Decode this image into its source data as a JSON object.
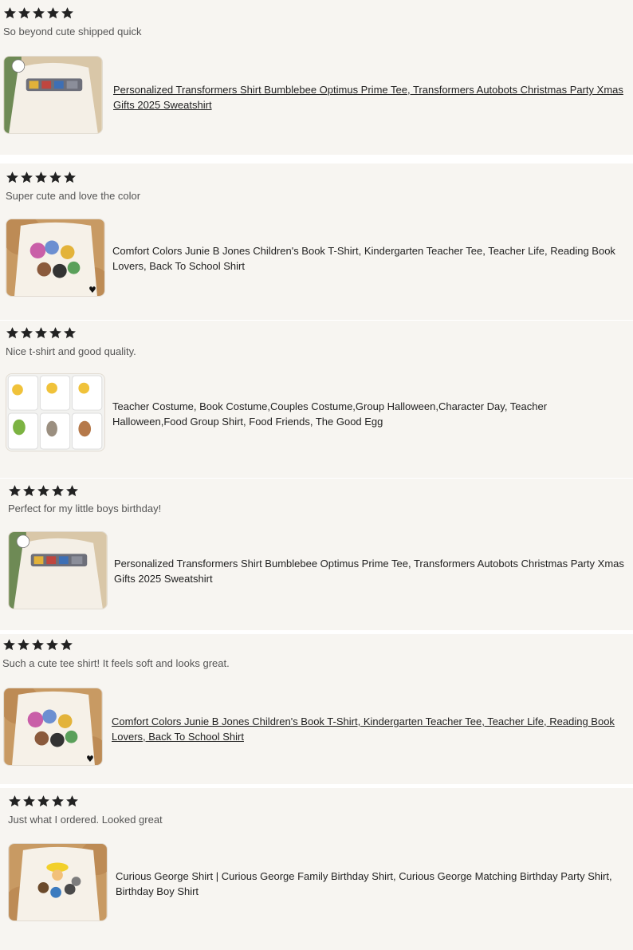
{
  "colors": {
    "card_bg": "#f7f5f1",
    "star": "#222222",
    "text_muted": "#555555"
  },
  "reviews": [
    {
      "rating": 5,
      "text": "So beyond cute shipped quick",
      "image": "transformers-shirt-photo",
      "product_title": "Personalized Transformers Shirt Bumblebee Optimus Prime Tee, Transformers Autobots Christmas Party Xmas Gifts 2025 Sweatshirt",
      "title_underlined": true
    },
    {
      "rating": 5,
      "text": "Super cute and love the color",
      "image": "junie-b-jones-shirt-photo",
      "product_title": "Comfort Colors Junie B Jones Children's Book T-Shirt, Kindergarten Teacher Tee, Teacher Life, Reading Book Lovers, Back To School Shirt",
      "title_underlined": false
    },
    {
      "rating": 5,
      "text": "Nice t-shirt and good quality.",
      "image": "food-group-shirts-photo",
      "product_title": "Teacher Costume, Book Costume,Couples Costume,Group Halloween,Character Day, Teacher Halloween,Food Group Shirt, Food Friends, The Good Egg",
      "title_underlined": false
    },
    {
      "rating": 5,
      "text": "Perfect for my little boys birthday!",
      "image": "transformers-shirt-photo",
      "product_title": "Personalized Transformers Shirt Bumblebee Optimus Prime Tee, Transformers Autobots Christmas Party Xmas Gifts 2025 Sweatshirt",
      "title_underlined": false
    },
    {
      "rating": 5,
      "text": "Such a cute tee shirt! It feels soft and looks great.",
      "image": "junie-b-jones-shirt-photo",
      "product_title": "Comfort Colors Junie B Jones Children's Book T-Shirt, Kindergarten Teacher Tee, Teacher Life, Reading Book Lovers, Back To School Shirt",
      "title_underlined": true
    },
    {
      "rating": 5,
      "text": "Just what I ordered. Looked great",
      "image": "curious-george-shirt-photo",
      "product_title": "Curious George Shirt | Curious George Family Birthday Shirt, Curious George Matching Birthday Party Shirt, Birthday Boy Shirt",
      "title_underlined": false
    }
  ]
}
